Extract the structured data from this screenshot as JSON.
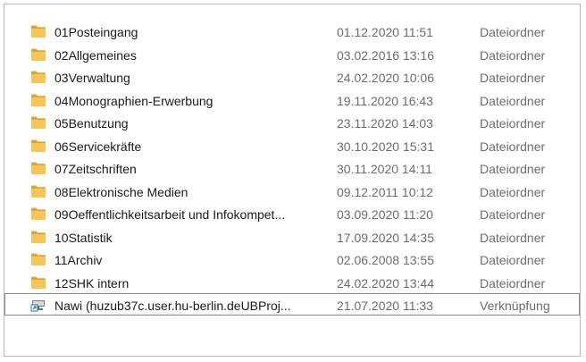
{
  "explorer": {
    "rows": [
      {
        "name": "01Posteingang",
        "date": "01.12.2020 11:51",
        "type": "Dateiordner",
        "icon": "folder-icon"
      },
      {
        "name": "02Allgemeines",
        "date": "03.02.2016 13:16",
        "type": "Dateiordner",
        "icon": "folder-icon"
      },
      {
        "name": "03Verwaltung",
        "date": "24.02.2020 10:06",
        "type": "Dateiordner",
        "icon": "folder-icon"
      },
      {
        "name": "04Monographien-Erwerbung",
        "date": "19.11.2020 16:43",
        "type": "Dateiordner",
        "icon": "folder-icon"
      },
      {
        "name": "05Benutzung",
        "date": "23.11.2020 14:03",
        "type": "Dateiordner",
        "icon": "folder-icon"
      },
      {
        "name": "06Servicekräfte",
        "date": "30.10.2020 15:31",
        "type": "Dateiordner",
        "icon": "folder-icon"
      },
      {
        "name": "07Zeitschriften",
        "date": "30.11.2020 14:11",
        "type": "Dateiordner",
        "icon": "folder-icon"
      },
      {
        "name": "08Elektronische Medien",
        "date": "09.12.2011 10:12",
        "type": "Dateiordner",
        "icon": "folder-icon"
      },
      {
        "name": "09Oeffentlichkeitsarbeit und Infokompet...",
        "date": "03.09.2020 11:20",
        "type": "Dateiordner",
        "icon": "folder-icon"
      },
      {
        "name": "10Statistik",
        "date": "17.09.2020 14:35",
        "type": "Dateiordner",
        "icon": "folder-icon"
      },
      {
        "name": "11Archiv",
        "date": "02.06.2008 13:55",
        "type": "Dateiordner",
        "icon": "folder-icon"
      },
      {
        "name": "12SHK intern",
        "date": "24.02.2020 13:44",
        "type": "Dateiordner",
        "icon": "folder-icon"
      },
      {
        "name": "Nawi (huzub37c.user.hu-berlin.deUBProj...",
        "date": "21.07.2020 11:33",
        "type": "Verknüpfung",
        "icon": "network-shortcut-icon",
        "selected": true
      }
    ]
  },
  "colors": {
    "folder_body": "#f6c555",
    "folder_tab": "#dca53b",
    "date_text": "#6d6d6d",
    "name_text": "#1a1a1a"
  }
}
